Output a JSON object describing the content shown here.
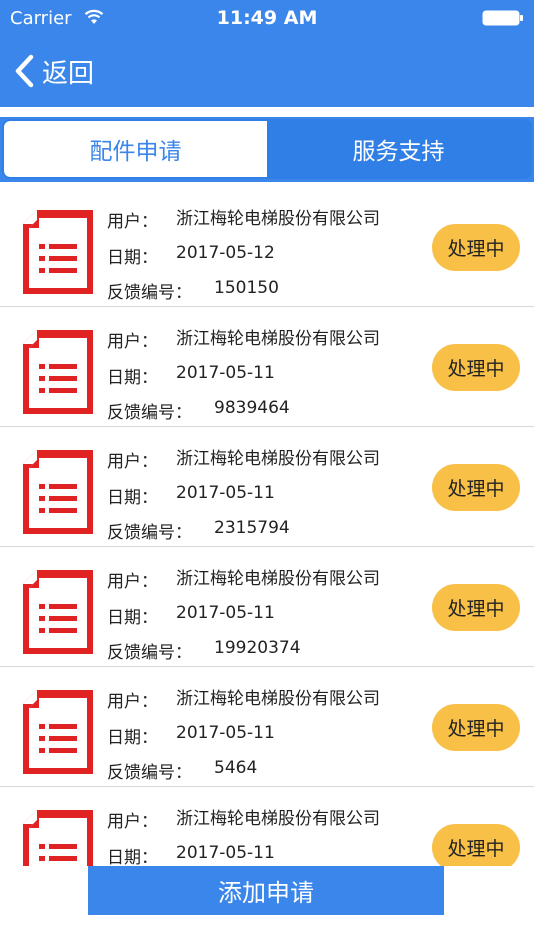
{
  "status_bar": {
    "carrier": "Carrier",
    "time": "11:49 AM"
  },
  "nav": {
    "back_label": "返回"
  },
  "tabs": [
    {
      "label": "配件申请",
      "active": true
    },
    {
      "label": "服务支持",
      "active": false
    }
  ],
  "list": {
    "user_label": "用户：",
    "date_label": "日期：",
    "feedback_label": "反馈编号：",
    "items": [
      {
        "user": "浙江梅轮电梯股份有限公司",
        "date": "2017-05-12",
        "feedback_no": "150150",
        "status": "处理中"
      },
      {
        "user": "浙江梅轮电梯股份有限公司",
        "date": "2017-05-11",
        "feedback_no": "9839464",
        "status": "处理中"
      },
      {
        "user": "浙江梅轮电梯股份有限公司",
        "date": "2017-05-11",
        "feedback_no": "2315794",
        "status": "处理中"
      },
      {
        "user": "浙江梅轮电梯股份有限公司",
        "date": "2017-05-11",
        "feedback_no": "19920374",
        "status": "处理中"
      },
      {
        "user": "浙江梅轮电梯股份有限公司",
        "date": "2017-05-11",
        "feedback_no": "5464",
        "status": "处理中"
      },
      {
        "user": "浙江梅轮电梯股份有限公司",
        "date": "2017-05-11",
        "feedback_no": "",
        "status": "处理中"
      }
    ]
  },
  "footer": {
    "add_label": "添加申请"
  },
  "colors": {
    "primary": "#3a86ea",
    "badge": "#f8c046",
    "icon_red": "#e02222"
  }
}
